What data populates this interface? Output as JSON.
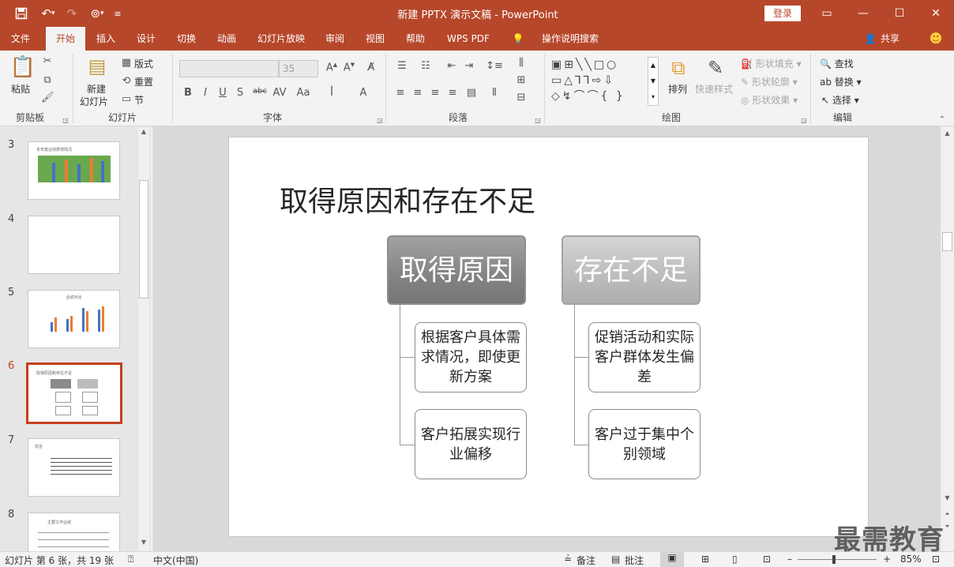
{
  "titlebar": {
    "title": "新建 PPTX 演示文稿  -  PowerPoint",
    "login": "登录",
    "save_icon": "save-icon",
    "undo_icon": "undo-icon"
  },
  "tabs": [
    "文件",
    "开始",
    "插入",
    "设计",
    "切换",
    "动画",
    "幻灯片放映",
    "审阅",
    "视图",
    "帮助",
    "WPS PDF",
    "操作说明搜索"
  ],
  "share": "共享",
  "ribbon": {
    "clipboard": {
      "paste": "粘贴",
      "label": "剪贴板"
    },
    "slides": {
      "new_slide_1": "新建",
      "new_slide_2": "幻灯片",
      "layout": "版式",
      "reset": "重置",
      "section": "节",
      "label": "幻灯片"
    },
    "font": {
      "label": "字体",
      "size": "35",
      "bold": "B",
      "italic": "I",
      "underline": "U",
      "strike": "S",
      "shadow": "abc"
    },
    "paragraph": {
      "label": "段落"
    },
    "drawing": {
      "arrange": "排列",
      "quick_styles": "快速样式",
      "fill": "形状填充",
      "outline": "形状轮廓",
      "effects": "形状效果",
      "label": "绘图"
    },
    "editing": {
      "find": "查找",
      "replace": "替换",
      "select": "选择",
      "label": "编辑"
    }
  },
  "thumbnails": [
    {
      "num": "3",
      "caption": "本年度业绩表现情况"
    },
    {
      "num": "4",
      "caption": ""
    },
    {
      "num": "5",
      "caption": "业绩对比"
    },
    {
      "num": "6",
      "caption": "取得原因和存在不足"
    },
    {
      "num": "7",
      "caption": "前言"
    },
    {
      "num": "8",
      "caption": "主要工作业绩"
    }
  ],
  "slide": {
    "title": "取得原因和存在不足",
    "left_header": "取得原因",
    "right_header": "存在不足",
    "left_items": [
      "根据客户具体需求情况，即使更新方案",
      "客户拓展实现行业偏移"
    ],
    "right_items": [
      "促销活动和实际客户群体发生偏差",
      "客户过于集中个别领域"
    ]
  },
  "status": {
    "slide_info": "幻灯片 第 6 张，共 19 张",
    "language": "中文(中国)",
    "notes": "备注",
    "comments": "批注",
    "zoom": "85%"
  },
  "watermark": "最需教育"
}
